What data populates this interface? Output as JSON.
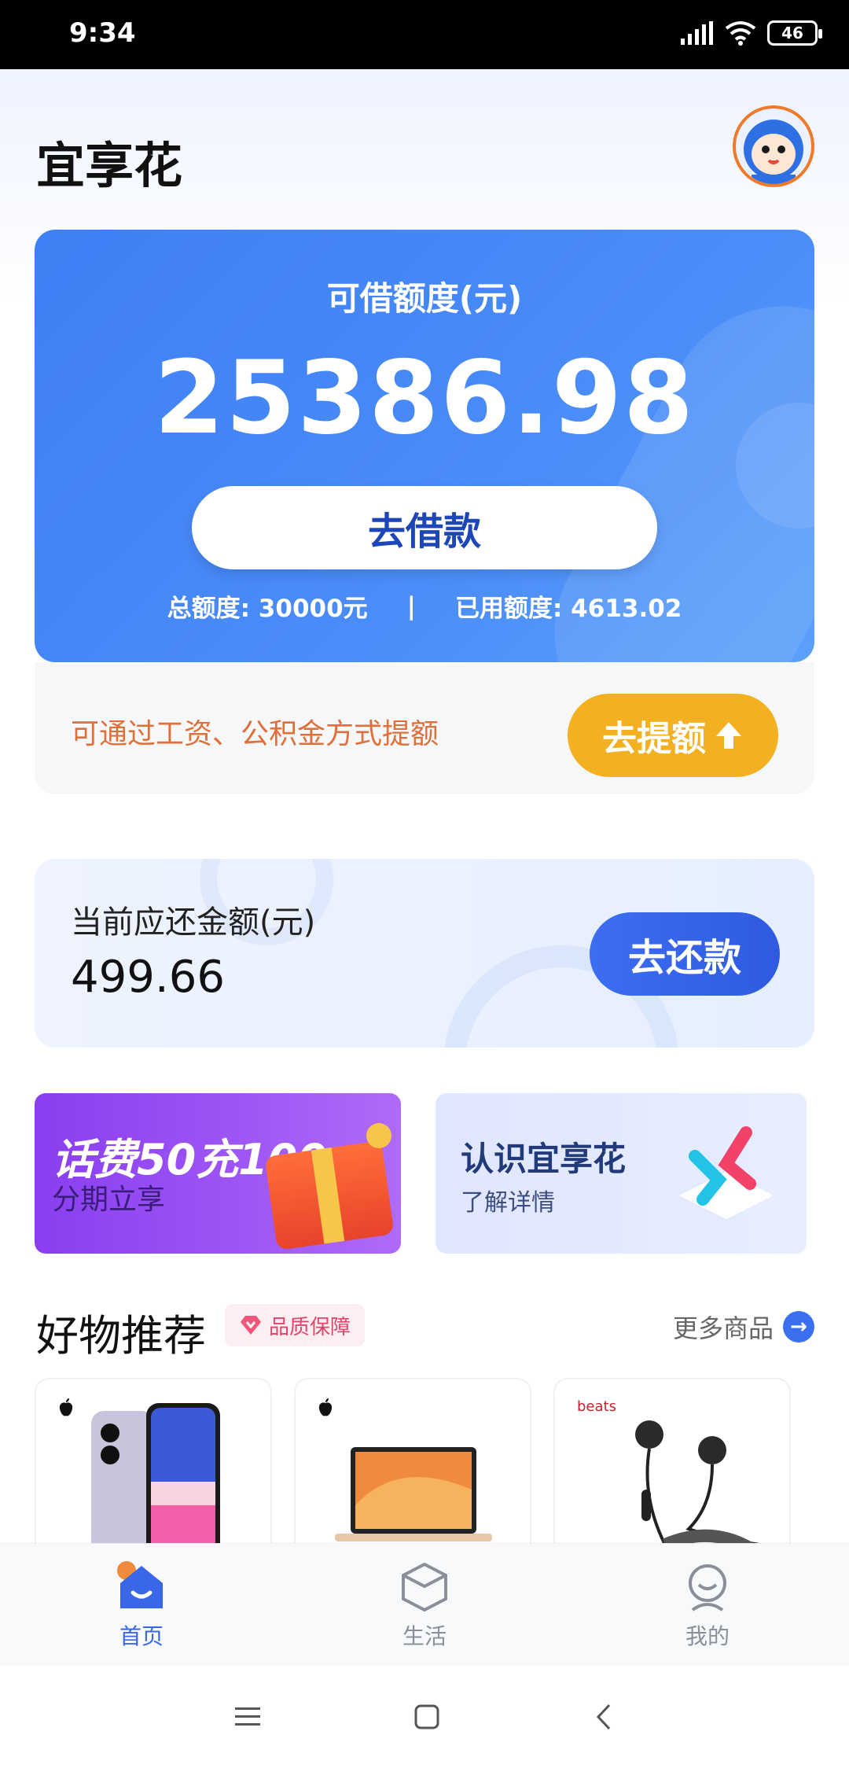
{
  "status_bar": {
    "time": "9:34",
    "battery": "46"
  },
  "app": {
    "title": "宜享花"
  },
  "credit": {
    "label": "可借额度(元)",
    "amount": "25386.98",
    "borrow_button": "去借款",
    "total_label": "总额度: 30000元",
    "separator": "|",
    "used_label": "已用额度: 4613.02"
  },
  "raise": {
    "text": "可通过工资、公积金方式提额",
    "button": "去提额"
  },
  "repay": {
    "label": "当前应还金额(元)",
    "amount": "499.66",
    "button": "去还款"
  },
  "banners": {
    "promo": {
      "main": "话费50充100",
      "sub": "分期立享"
    },
    "about": {
      "title": "认识宜享花",
      "sub": "了解详情"
    }
  },
  "products": {
    "title": "好物推荐",
    "badge": "品质保障",
    "more": "更多商品",
    "items": [
      {
        "brand_icon": "apple-logo-icon"
      },
      {
        "brand_icon": "apple-logo-icon"
      },
      {
        "brand": "beats"
      }
    ]
  },
  "tabs": [
    {
      "label": "首页",
      "icon": "home-icon",
      "active": true
    },
    {
      "label": "生活",
      "icon": "life-icon",
      "active": false
    },
    {
      "label": "我的",
      "icon": "profile-icon",
      "active": false
    }
  ],
  "colors": {
    "primary": "#3f7ff5",
    "accent": "#f3b020",
    "tab_active": "#3a66e8"
  }
}
